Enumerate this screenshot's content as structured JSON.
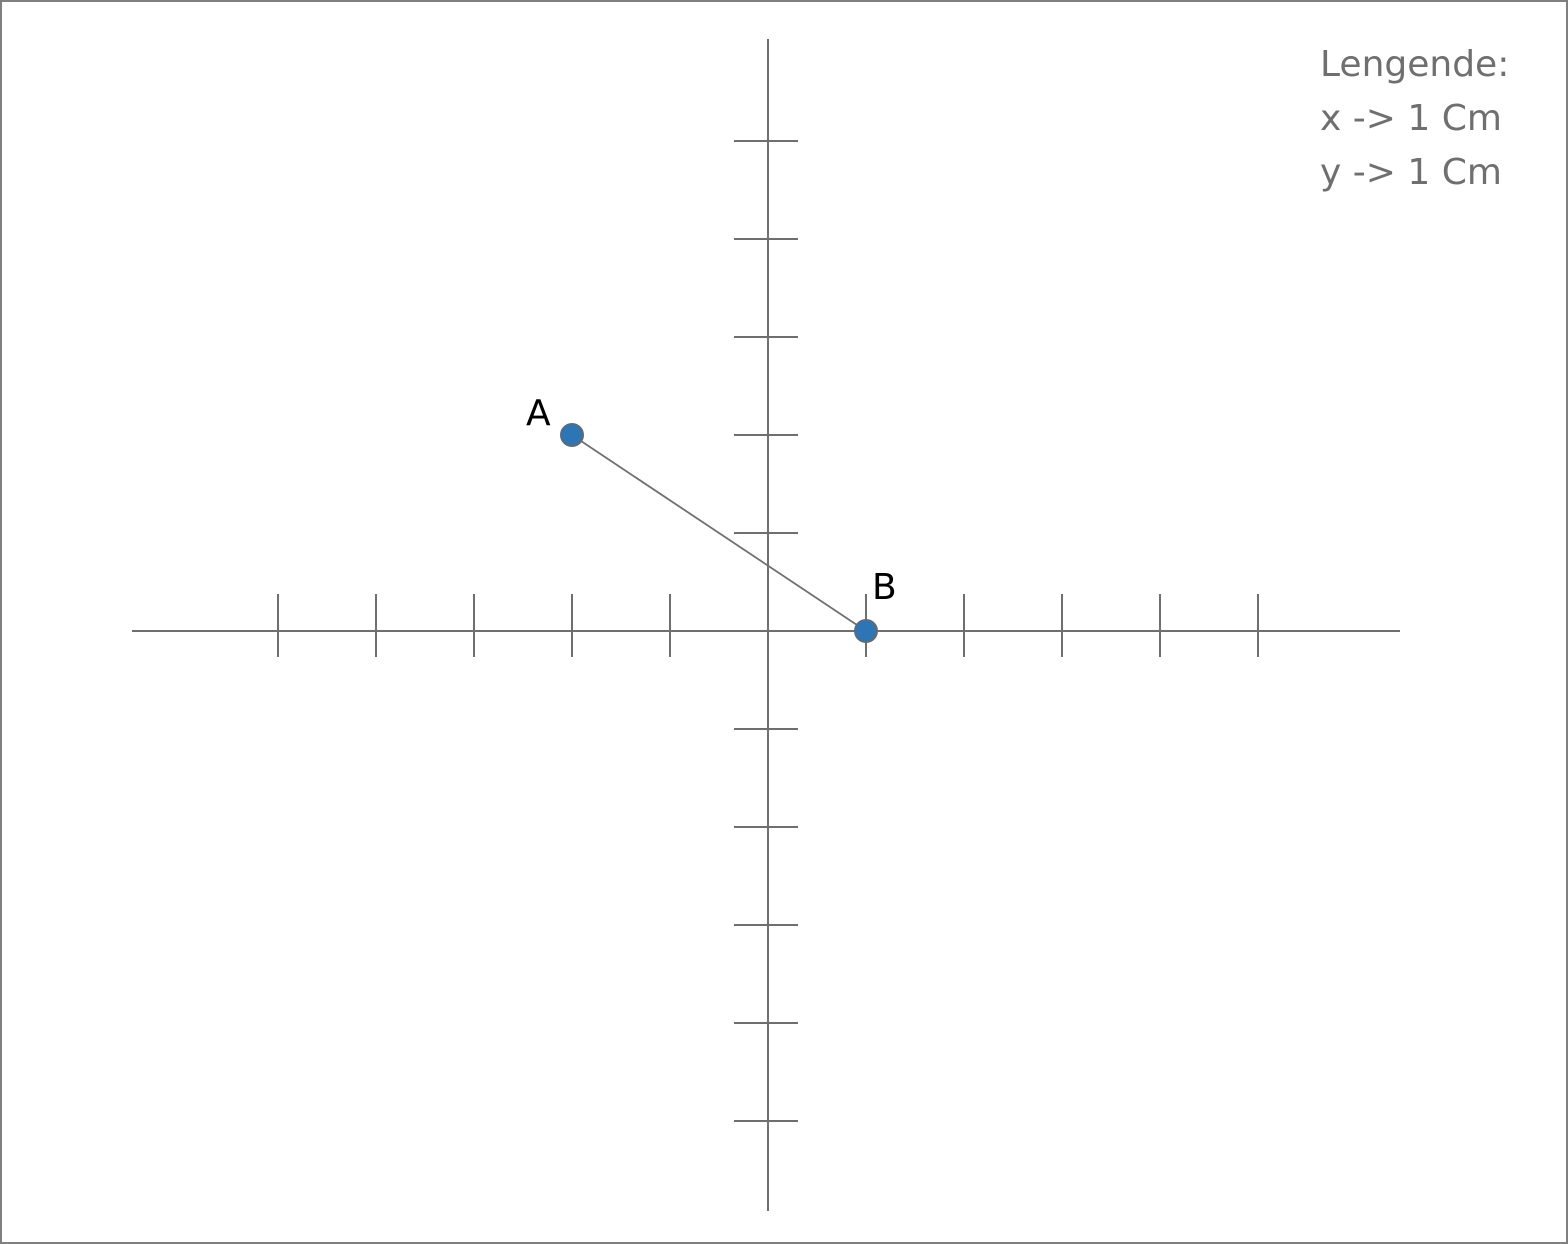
{
  "diagram": {
    "type": "coordinate-plane",
    "x_ticks": [
      -5,
      -4,
      -3,
      -2,
      -1,
      1,
      2,
      3,
      4,
      5
    ],
    "y_ticks": [
      5,
      4,
      3,
      2,
      1,
      -1,
      -2,
      -3,
      -4,
      -5
    ],
    "points": [
      {
        "id": "point-a",
        "label": "A",
        "x": -2,
        "y": 2,
        "label_side": "upper-left"
      },
      {
        "id": "point-b",
        "label": "B",
        "x": 1,
        "y": 0,
        "label_side": "upper-right"
      }
    ],
    "segments": [
      {
        "from": "A",
        "to": "B"
      }
    ],
    "colors": {
      "axis": "#6f6f6f",
      "point_fill": "#2e75b6",
      "point_stroke": "#5a6b7a",
      "legend_text": "#6f6f6f",
      "label_text": "#000000"
    }
  },
  "legend": {
    "title": "Lengende:",
    "x_scale": "x -> 1 Cm",
    "y_scale": "y -> 1 Cm"
  }
}
